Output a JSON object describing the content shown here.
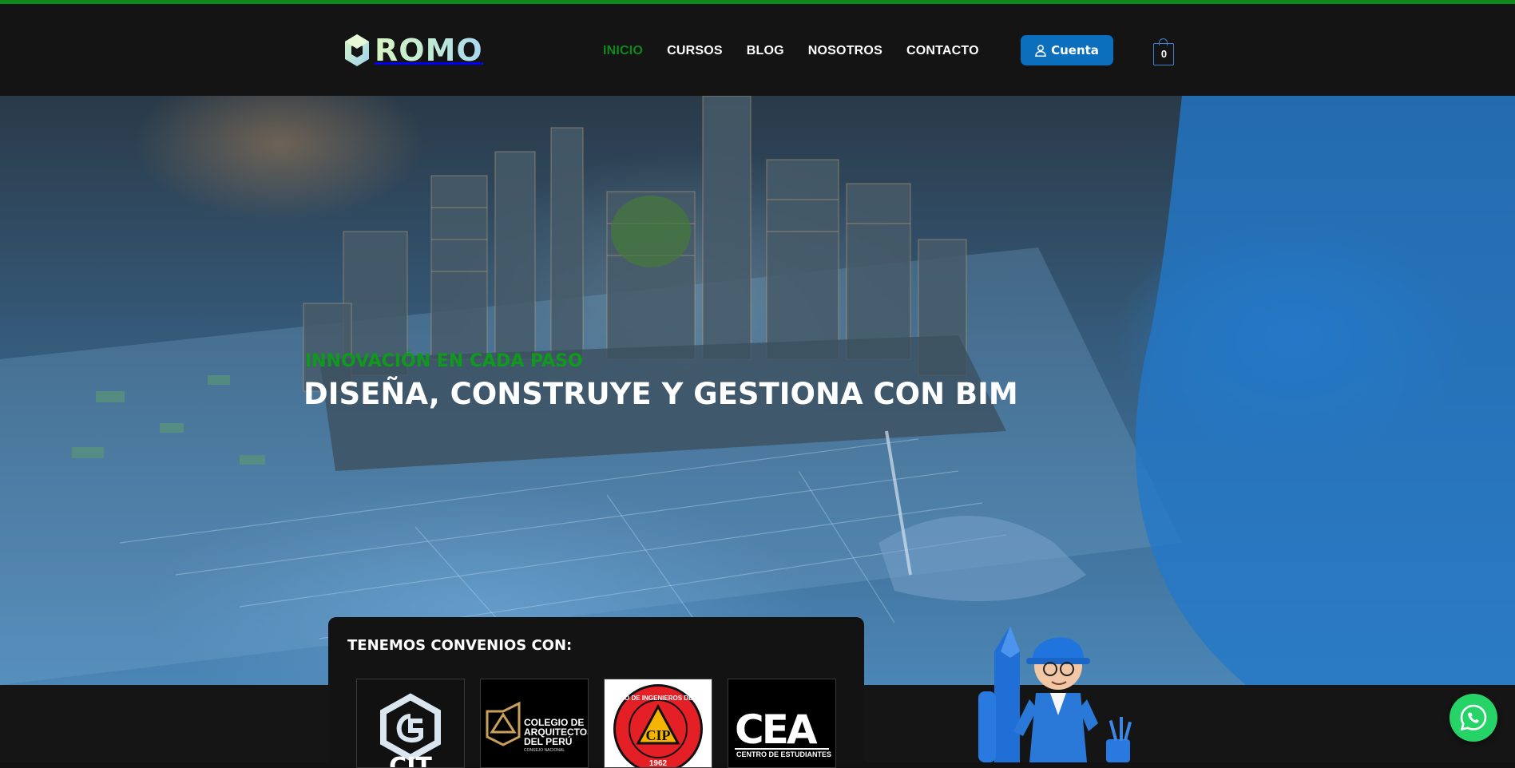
{
  "brand": {
    "name": "ROMO"
  },
  "nav": {
    "items": [
      {
        "label": "INICIO",
        "active": true
      },
      {
        "label": "CURSOS",
        "active": false
      },
      {
        "label": "BLOG",
        "active": false
      },
      {
        "label": "NOSOTROS",
        "active": false
      },
      {
        "label": "CONTACTO",
        "active": false
      }
    ]
  },
  "account": {
    "label": "Cuenta",
    "icon": "user-icon"
  },
  "cart": {
    "count": "0",
    "icon": "shopping-bag-icon"
  },
  "hero": {
    "subtitle": "INNOVACIÓN EN CADA PASO",
    "title": "DISEÑA, CONSTRUYE Y GESTIONA CON BIM"
  },
  "partners": {
    "heading": "TENEMOS CONVENIOS CON:",
    "logos": [
      {
        "text": "CIT"
      },
      {
        "text": "COLEGIO DE ARQUITECTOS DEL PERÚ",
        "subtext": "CONSEJO NACIONAL"
      },
      {
        "text": "COLEGIO DE INGENIEROS DEL PERU",
        "year": "1962",
        "monogram": "CIP"
      },
      {
        "text": "CEA",
        "subtext": "CENTRO DE ESTUDIANTES"
      }
    ]
  },
  "floating": {
    "whatsapp_icon": "whatsapp-icon"
  },
  "colors": {
    "accent_green": "#10891c",
    "button_blue": "#0b6fbd",
    "header_bg": "#141414",
    "whatsapp_green": "#25d366"
  }
}
